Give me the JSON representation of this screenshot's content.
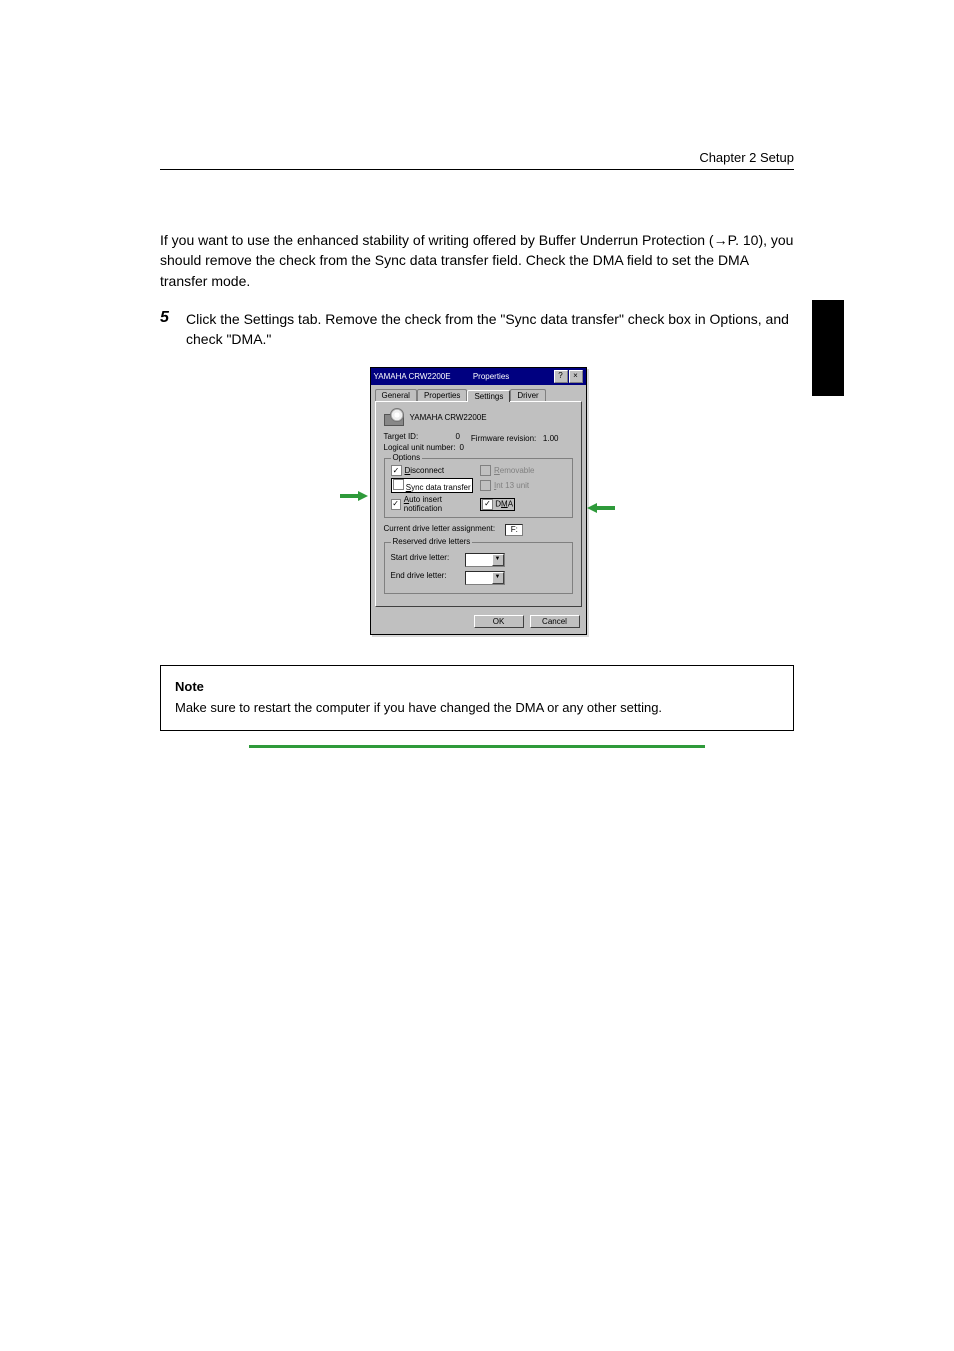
{
  "header_breadcrumb": "Chapter 2  Setup",
  "intro_text": "If you want to use the enhanced stability of writing offered by Buffer Underrun Protection (→P. 10), you should remove the check from the Sync data transfer field. Check the DMA field to set the DMA transfer mode.",
  "step_num": "5",
  "step_text": "Click the Settings tab. Remove the check from the \"Sync data transfer\" check box in Options, and check \"DMA.\"",
  "dialog": {
    "title_left": "YAMAHA CRW2200E",
    "title_right": "Properties",
    "close_help": "?",
    "close_x": "×",
    "tabs": {
      "general": "General",
      "properties": "Properties",
      "settings": "Settings",
      "driver": "Driver"
    },
    "device_name": "YAMAHA CRW2200E",
    "target_id_k": "Target ID:",
    "target_id_v": "0",
    "fw_k": "Firmware revision:",
    "fw_v": "1.00",
    "lun_k": "Logical unit number:",
    "lun_v": "0",
    "options_legend": "Options",
    "chk_disconnect": "Disconnect",
    "chk_removable": "Removable",
    "chk_sync": "Sync data transfer",
    "chk_int13": "Int 13 unit",
    "chk_auto": "Auto insert notification",
    "chk_dma": "DMA",
    "cur_drv_k": "Current drive letter assignment:",
    "cur_drv_v": "F:",
    "reserved_legend": "Reserved drive letters",
    "start_k": "Start drive letter:",
    "end_k": "End drive letter:",
    "ok": "OK",
    "cancel": "Cancel"
  },
  "note_title": "Note",
  "note_body": "Make sure to restart the computer if you have changed the DMA or any other setting."
}
